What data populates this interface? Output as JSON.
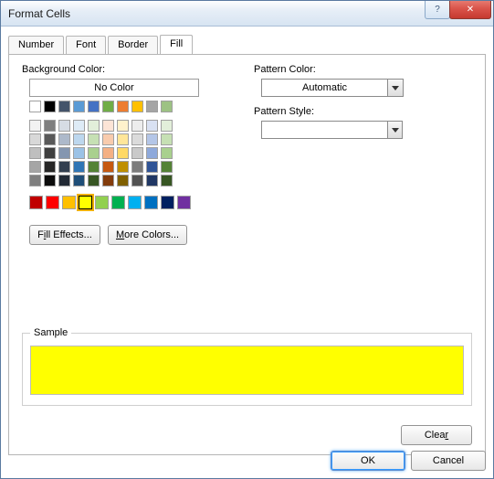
{
  "window": {
    "title": "Format Cells"
  },
  "tabs": {
    "number": "Number",
    "font": "Font",
    "border": "Border",
    "fill": "Fill"
  },
  "labels": {
    "bg": "Background Color:",
    "nocolor": "No Color",
    "pc": "Pattern Color:",
    "ps": "Pattern Style:",
    "sample": "Sample"
  },
  "combos": {
    "pattern_color": "Automatic",
    "pattern_style": ""
  },
  "buttons": {
    "fill_effects_pre": "F",
    "fill_effects_u": "i",
    "fill_effects_post": "ll Effects...",
    "more_colors_u": "M",
    "more_colors_post": "ore Colors...",
    "clear_prefix": "Clea",
    "clear_u": "r",
    "ok": "OK",
    "cancel": "Cancel"
  },
  "theme_row1": [
    "#ffffff",
    "#000000",
    "#44546a",
    "#5b9bd5",
    "#4472c4",
    "#70ad47",
    "#ed7d31",
    "#ffc000",
    "#a5a5a5",
    "#9dc284"
  ],
  "theme_shades": [
    [
      "#f2f2f2",
      "#7f7f7f",
      "#d6dce4",
      "#deebf6",
      "#e2efda",
      "#fce4d6",
      "#fff2cc",
      "#ededed",
      "#d9e1f2",
      "#e2efda"
    ],
    [
      "#d8d8d8",
      "#595959",
      "#adb9ca",
      "#bdd7ee",
      "#c6e0b4",
      "#f8cbad",
      "#ffe699",
      "#dbdbdb",
      "#b4c6e7",
      "#c6e0b4"
    ],
    [
      "#bfbfbf",
      "#3f3f3f",
      "#8496b0",
      "#9bc2e6",
      "#a9d08e",
      "#f4b084",
      "#ffd966",
      "#c9c9c9",
      "#8ea9db",
      "#a9d08e"
    ],
    [
      "#a5a5a5",
      "#262626",
      "#323f4f",
      "#2f75b5",
      "#548235",
      "#c65911",
      "#bf8f00",
      "#7b7b7b",
      "#305496",
      "#548235"
    ],
    [
      "#7f7f7f",
      "#0c0c0c",
      "#222a35",
      "#1f4e78",
      "#375623",
      "#833c0c",
      "#806000",
      "#525252",
      "#203764",
      "#375623"
    ]
  ],
  "standard": [
    "#c00000",
    "#ff0000",
    "#ffc000",
    "#ffff00",
    "#92d050",
    "#00b050",
    "#00b0f0",
    "#0070c0",
    "#002060",
    "#7030a0"
  ],
  "selected_standard_index": 3,
  "sample_color": "#ffff00"
}
